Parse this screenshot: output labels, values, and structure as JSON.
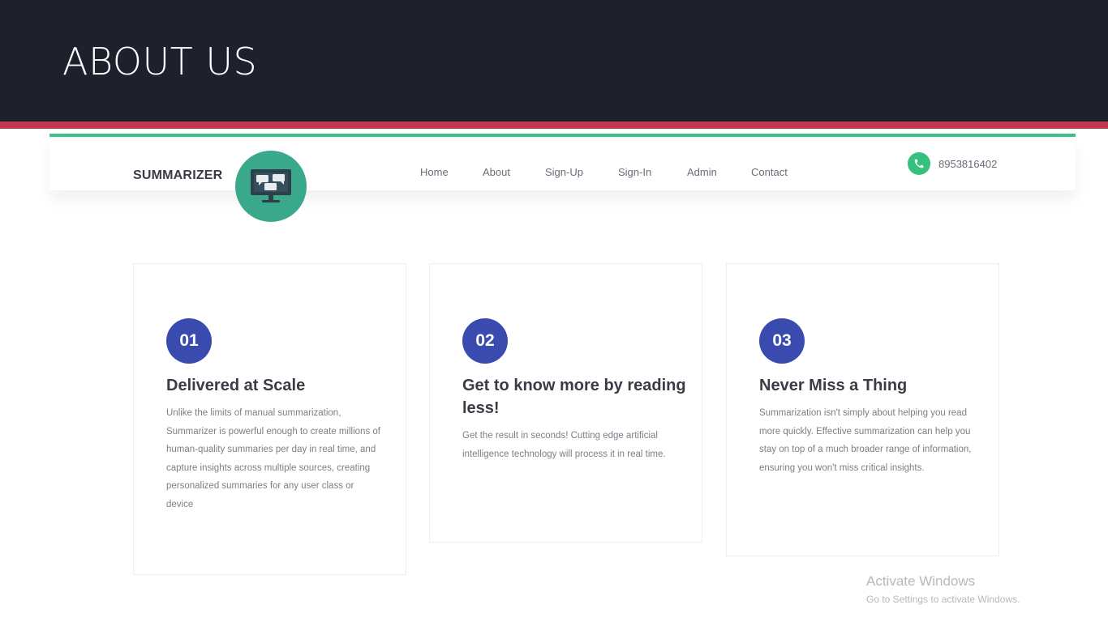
{
  "slide": {
    "title": "ABOUT US"
  },
  "site": {
    "brand": "SUMMARIZER",
    "nav": [
      "Home",
      "About",
      "Sign-Up",
      "Sign-In",
      "Admin",
      "Contact"
    ],
    "phone": "8953816402",
    "colors": {
      "header_bg": "#1e202c",
      "red_band": "#c0394e",
      "accent_green": "#3cc08a",
      "logo_bg": "#3aa88a",
      "badge_blue": "#3a4bb0"
    }
  },
  "cards": [
    {
      "number": "01",
      "title": "Delivered at Scale",
      "body": "Unlike the limits of manual summarization, Summarizer is powerful enough to create millions of human-quality summaries per day in real time, and capture insights across multiple sources, creating personalized summaries for any user class or device"
    },
    {
      "number": "02",
      "title": "Get to know more by reading less!",
      "body": "Get the result in seconds! Cutting edge artificial intelligence technology will process it in real time."
    },
    {
      "number": "03",
      "title": "Never Miss a Thing",
      "body": "Summarization isn't simply about helping you read more quickly. Effective summarization can help you stay on top of a much broader range of information, ensuring you won't miss critical insights."
    }
  ],
  "watermark": {
    "line1": "Activate Windows",
    "line2": "Go to Settings to activate Windows."
  }
}
